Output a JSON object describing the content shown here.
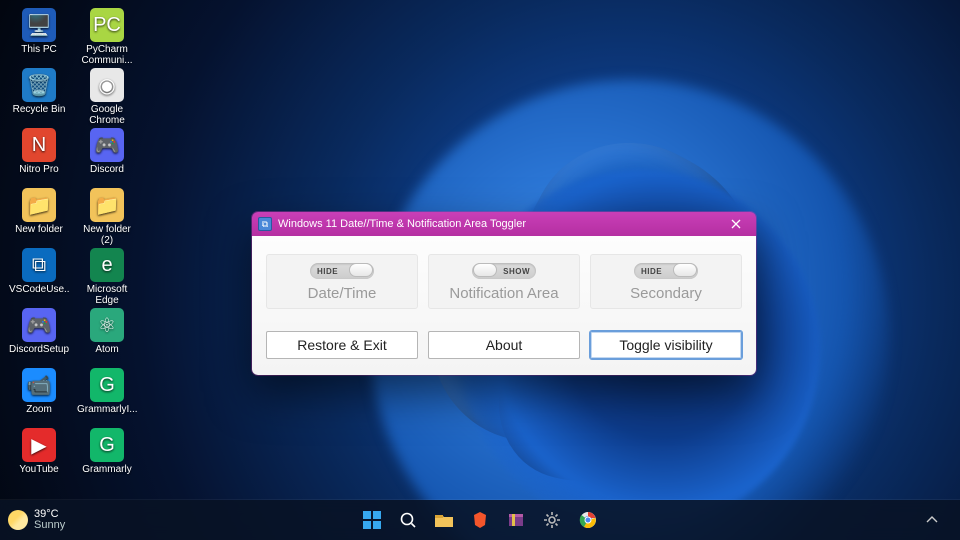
{
  "desktop": {
    "icons": [
      {
        "name": "this-pc",
        "label": "This PC",
        "bg": "#1e5bb8"
      },
      {
        "name": "pycharm",
        "label": "PyCharm Communi...",
        "bg": "#a9d643"
      },
      {
        "name": "recycle-bin",
        "label": "Recycle Bin",
        "bg": "#1f7bc7"
      },
      {
        "name": "chrome",
        "label": "Google Chrome",
        "bg": "#e8e8e8"
      },
      {
        "name": "nitro-pro",
        "label": "Nitro Pro",
        "bg": "#e1462e"
      },
      {
        "name": "discord",
        "label": "Discord",
        "bg": "#5865f2"
      },
      {
        "name": "new-folder",
        "label": "New folder",
        "bg": "#f2c35a"
      },
      {
        "name": "new-folder-2",
        "label": "New folder (2)",
        "bg": "#f2c35a"
      },
      {
        "name": "vscode",
        "label": "VSCodeUse...",
        "bg": "#0a6bbf"
      },
      {
        "name": "edge",
        "label": "Microsoft Edge",
        "bg": "#13854f"
      },
      {
        "name": "discord-setup",
        "label": "DiscordSetup",
        "bg": "#5865f2"
      },
      {
        "name": "atom",
        "label": "Atom",
        "bg": "#2aa87c"
      },
      {
        "name": "zoom",
        "label": "Zoom",
        "bg": "#1b8cff"
      },
      {
        "name": "grammarly-in",
        "label": "GrammarlyI...",
        "bg": "#12b76a"
      },
      {
        "name": "youtube",
        "label": "YouTube",
        "bg": "#e42b2b"
      },
      {
        "name": "grammarly",
        "label": "Grammarly",
        "bg": "#12b76a"
      }
    ]
  },
  "app": {
    "title": "Windows 11 Date//Time & Notification Area Toggler",
    "toggles": [
      {
        "name": "datetime",
        "label": "Date/Time",
        "state": "HIDE"
      },
      {
        "name": "notification",
        "label": "Notification Area",
        "state": "SHOW"
      },
      {
        "name": "secondary",
        "label": "Secondary",
        "state": "HIDE"
      }
    ],
    "buttons": {
      "restore": "Restore & Exit",
      "about": "About",
      "toggle": "Toggle visibility"
    }
  },
  "taskbar": {
    "weather": {
      "temp": "39°C",
      "cond": "Sunny"
    }
  }
}
